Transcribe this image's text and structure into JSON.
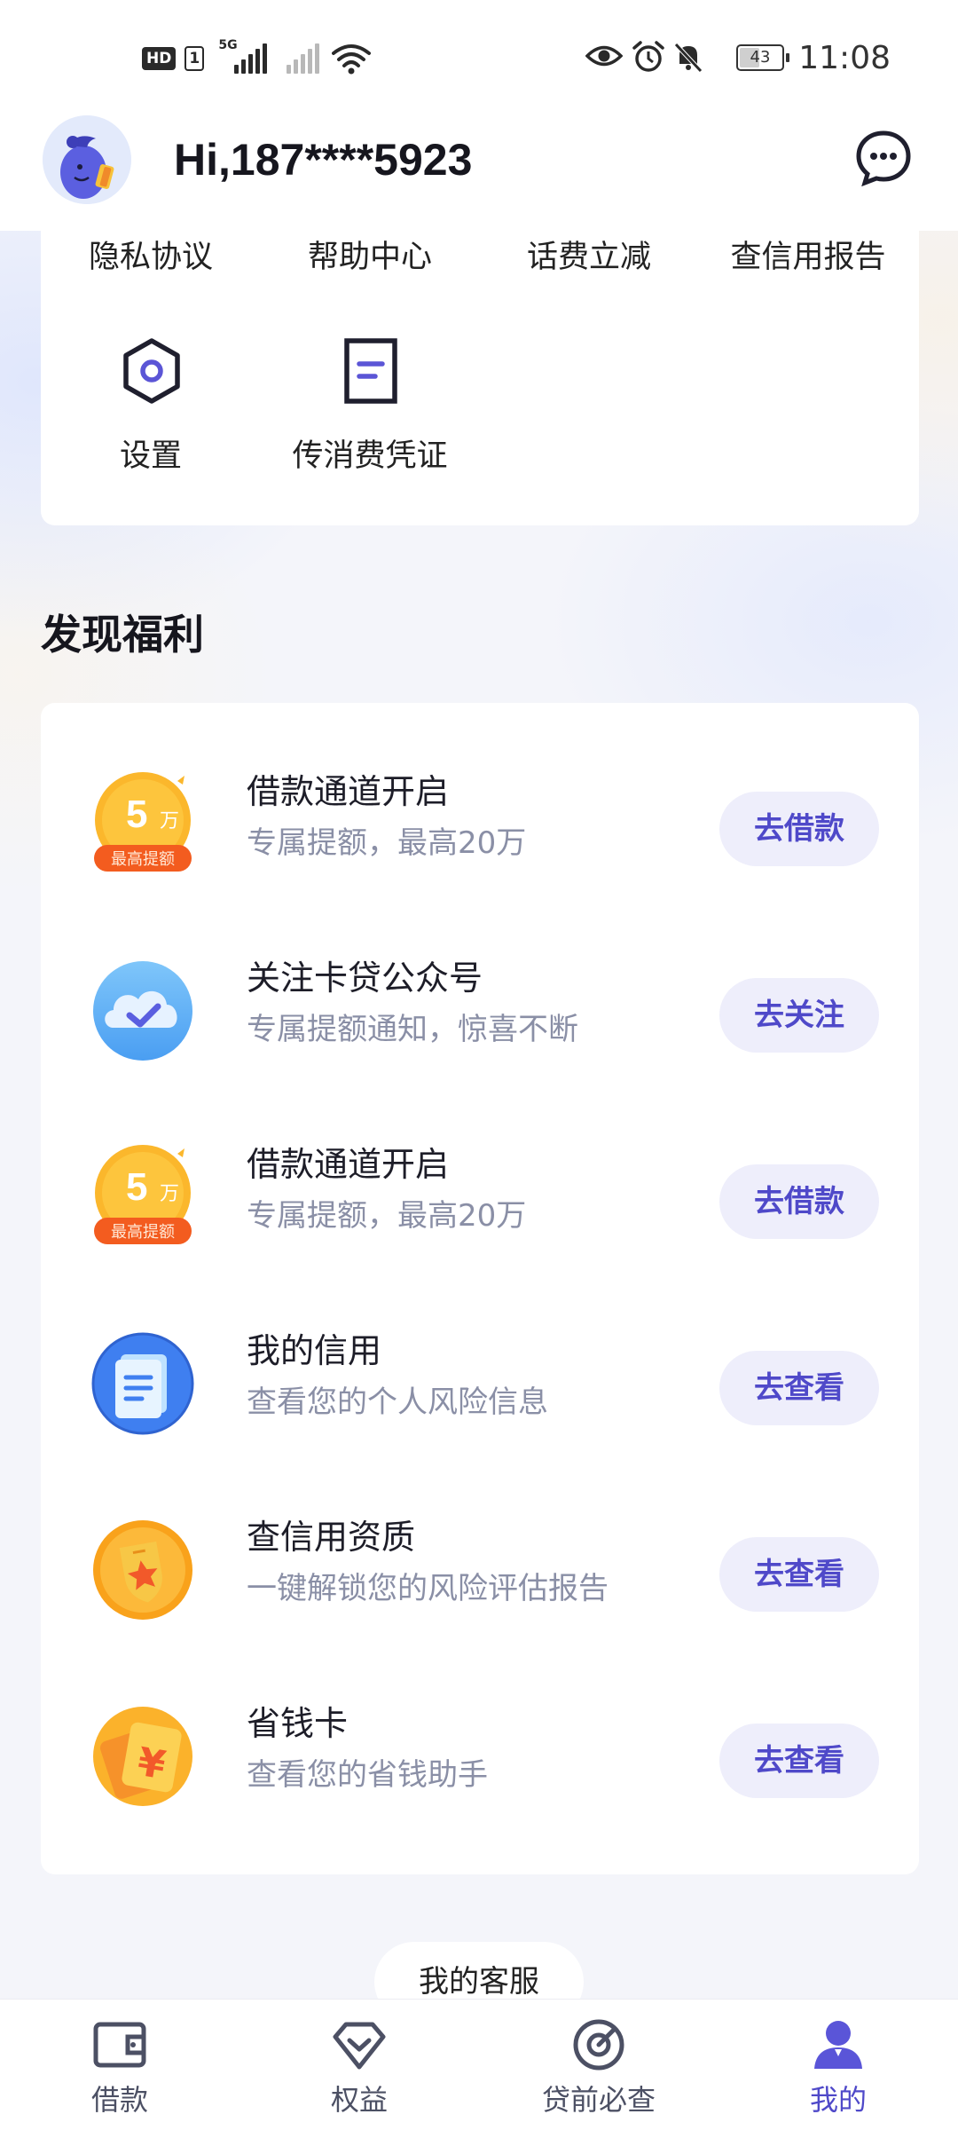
{
  "status_bar": {
    "hd": "HD",
    "sim": "1",
    "network": "5G",
    "battery": "43",
    "time": "11:08"
  },
  "header": {
    "greeting": "Hi,187****5923",
    "avatar_icon": "mascot-avatar-icon",
    "message_icon": "chat-bubble-icon"
  },
  "quick_links": [
    {
      "label": "隐私协议"
    },
    {
      "label": "帮助中心"
    },
    {
      "label": "话费立减"
    },
    {
      "label": "查信用报告"
    }
  ],
  "tools": [
    {
      "label": "设置",
      "icon": "hexagon-settings-icon"
    },
    {
      "label": "传消费凭证",
      "icon": "document-icon"
    }
  ],
  "section": {
    "title": "发现福利"
  },
  "offers": [
    {
      "title": "借款通道开启",
      "subtitle": "专属提额，最高20万",
      "button": "去借款",
      "icon": "coin-5wan-icon",
      "badge_num": "5",
      "badge_unit": "万",
      "badge_tag": "最高提额"
    },
    {
      "title": "关注卡贷公众号",
      "subtitle": "专属提额通知，惊喜不断",
      "button": "去关注",
      "icon": "cloud-check-icon"
    },
    {
      "title": "借款通道开启",
      "subtitle": "专属提额，最高20万",
      "button": "去借款",
      "icon": "coin-5wan-icon",
      "badge_num": "5",
      "badge_unit": "万",
      "badge_tag": "最高提额"
    },
    {
      "title": "我的信用",
      "subtitle": "查看您的个人风险信息",
      "button": "去查看",
      "icon": "credit-document-icon"
    },
    {
      "title": "查信用资质",
      "subtitle": "一键解锁您的风险评估报告",
      "button": "去查看",
      "icon": "shield-star-icon"
    },
    {
      "title": "省钱卡",
      "subtitle": "查看您的省钱助手",
      "button": "去查看",
      "icon": "yuan-card-icon"
    }
  ],
  "customer_service": {
    "label": "我的客服"
  },
  "tabbar": [
    {
      "label": "借款",
      "icon": "wallet-icon",
      "active": false
    },
    {
      "label": "权益",
      "icon": "diamond-heart-icon",
      "active": false
    },
    {
      "label": "贷前必查",
      "icon": "target-icon",
      "active": false
    },
    {
      "label": "我的",
      "icon": "person-icon",
      "active": true
    }
  ],
  "colors": {
    "accent": "#4f49c9",
    "button_bg": "#eeeefb",
    "subtitle": "#8a8fa6",
    "tab_inactive": "#4c5064"
  }
}
